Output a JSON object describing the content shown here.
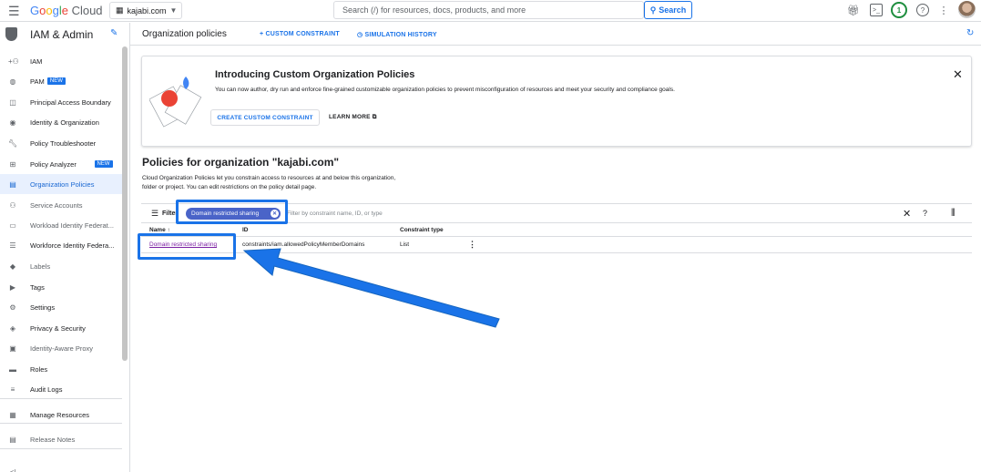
{
  "topbar": {
    "logo_google": "Google",
    "logo_cloud": " Cloud",
    "project": "kajabi.com",
    "search_placeholder": "Search (/) for resources, docs, products, and more",
    "search_button": "Search",
    "notification_count": "1"
  },
  "sidebar": {
    "title": "IAM & Admin",
    "items": [
      {
        "label": "IAM",
        "icon": "person-add-icon"
      },
      {
        "label": "PAM",
        "badge": "NEW",
        "icon": "shield-clock-icon"
      },
      {
        "label": "Principal Access Boundary",
        "icon": "boundary-icon"
      },
      {
        "label": "Identity & Organization",
        "icon": "identity-icon"
      },
      {
        "label": "Policy Troubleshooter",
        "icon": "wrench-icon"
      },
      {
        "label": "Policy Analyzer",
        "badge": "NEW",
        "icon": "analyzer-icon"
      },
      {
        "label": "Organization Policies",
        "icon": "doc-icon"
      },
      {
        "label": "Service Accounts",
        "icon": "service-account-icon"
      },
      {
        "label": "Workload Identity Federat...",
        "icon": "card-icon"
      },
      {
        "label": "Workforce Identity Federa...",
        "icon": "list-icon"
      },
      {
        "label": "Labels",
        "icon": "label-icon"
      },
      {
        "label": "Tags",
        "icon": "tag-icon"
      },
      {
        "label": "Settings",
        "icon": "gear-icon"
      },
      {
        "label": "Privacy & Security",
        "icon": "shield-icon"
      },
      {
        "label": "Identity-Aware Proxy",
        "icon": "proxy-icon"
      },
      {
        "label": "Roles",
        "icon": "roles-icon"
      },
      {
        "label": "Audit Logs",
        "icon": "audit-icon"
      },
      {
        "label": "Manage Resources",
        "icon": "folder-icon"
      },
      {
        "label": "Release Notes",
        "icon": "notes-icon"
      }
    ]
  },
  "header": {
    "title": "Organization policies",
    "custom_constraint": "CUSTOM CONSTRAINT",
    "simulation_history": "SIMULATION HISTORY"
  },
  "banner": {
    "title": "Introducing Custom Organization Policies",
    "description": "You can now author, dry run and enforce fine-grained customizable organization policies to prevent misconfiguration of resources and meet your security and compliance goals.",
    "create_button": "CREATE CUSTOM CONSTRAINT",
    "learn_more": "LEARN MORE"
  },
  "policies": {
    "title": "Policies for organization \"kajabi.com\"",
    "description": "Cloud Organization Policies let you constrain access to resources at and below this organization, folder or project. You can edit restrictions on the policy detail page.",
    "filter_label": "Filter",
    "chip_label": "Domain restricted sharing",
    "filter_placeholder": "Filter by constraint name, ID, or type",
    "columns": {
      "name": "Name",
      "id": "ID",
      "type": "Constraint type"
    },
    "rows": [
      {
        "name": "Domain restricted sharing",
        "id": "constraints/iam.allowedPolicyMemberDomains",
        "type": "List"
      }
    ]
  },
  "colors": {
    "accent": "#1a73e8",
    "highlight": "#1a73e8",
    "chip": "#4a64c8"
  }
}
